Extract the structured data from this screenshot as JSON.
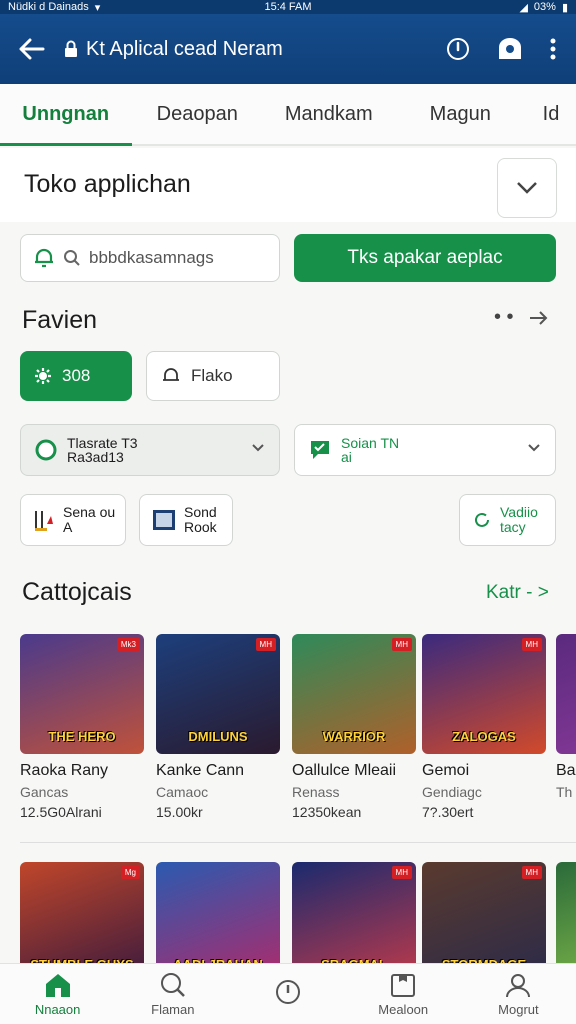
{
  "status_bar": {
    "carrier": "Nüdki d Dainads",
    "time": "15:4 FAM",
    "battery": "03%"
  },
  "app_bar": {
    "title": "Kt Aplical cead Neram"
  },
  "tabs": [
    {
      "label": "Unngnan",
      "active": true
    },
    {
      "label": "Deaopan"
    },
    {
      "label": "Mandkam"
    },
    {
      "label": "Magun"
    },
    {
      "label": "Id"
    }
  ],
  "store": {
    "title": "Toko applichan",
    "search_placeholder": "bbbdkasamnags",
    "install_button": "Tks apakar aeplac"
  },
  "favorites": {
    "title": "Favien",
    "more_dots": "• •",
    "arrow": "->",
    "chip_active": "308",
    "chip_other": "Flako",
    "select_left_line1": "Tlasrate T3",
    "select_left_line2": "Ra3ad13",
    "select_right_line1": "Soian TN",
    "select_right_line2": "ai",
    "small_chip_1_line1": "Sena ou",
    "small_chip_1_line2": "A",
    "small_chip_2_line1": "Sond",
    "small_chip_2_line2": "Rook",
    "small_chip_3_line1": "Vadiio",
    "small_chip_3_line2": "tacy"
  },
  "categories": {
    "title": "Cattojcais",
    "see_all": "Katr - >",
    "games": [
      {
        "name": "Raoka Rany",
        "genre": "Gancas",
        "size": "12.5G0Alrani",
        "badge": "Mk3",
        "art": "THE HERO",
        "colors": [
          "#4a3a8c",
          "#c0523a"
        ]
      },
      {
        "name": "Kanke Cann",
        "genre": "Camaoc",
        "size": "15.00kr",
        "badge": "MH",
        "art": "DMILUNS",
        "colors": [
          "#1d3f7c",
          "#2a1a2e"
        ]
      },
      {
        "name": "Oallulce Mleaii",
        "genre": "Renass",
        "size": "12350kean",
        "badge": "MH",
        "art": "WARRIOR",
        "colors": [
          "#2e8a5a",
          "#b0602a"
        ]
      },
      {
        "name": "Gemoi",
        "genre": "Gendiagc",
        "size": "7?.30ert",
        "badge": "MH",
        "art": "ZALOGAS",
        "colors": [
          "#3a2a7e",
          "#d24a2a"
        ]
      },
      {
        "name": "Ba",
        "genre": "Th",
        "size": "",
        "badge": "",
        "art": "",
        "colors": [
          "#5a2a7e",
          "#8a3a9a"
        ]
      }
    ],
    "row2": [
      {
        "art": "STUMBLE GUYS",
        "badge": "Mg",
        "colors": [
          "#c0462a",
          "#3a1a3e"
        ]
      },
      {
        "art": "AADI JRAHAN",
        "badge": "",
        "colors": [
          "#2a5ab0",
          "#b02a6a"
        ]
      },
      {
        "art": "SRAGMAL",
        "badge": "MH",
        "colors": [
          "#1a2a6e",
          "#c03a4a"
        ]
      },
      {
        "art": "STORMDAGE",
        "badge": "MH",
        "colors": [
          "#5a3a2e",
          "#2a2a4a"
        ]
      },
      {
        "art": "",
        "badge": "",
        "colors": [
          "#2a6a3a",
          "#8ac04a"
        ]
      }
    ]
  },
  "bottom_nav": [
    {
      "label": "Nnaaon",
      "icon": "home-icon",
      "active": true
    },
    {
      "label": "Flaman",
      "icon": "search-icon"
    },
    {
      "label": "",
      "icon": "compass-icon"
    },
    {
      "label": "Mealoon",
      "icon": "library-icon"
    },
    {
      "label": "Mogrut",
      "icon": "profile-icon"
    }
  ],
  "colors": {
    "accent": "#17904a",
    "app_bar": "#154c8c"
  }
}
